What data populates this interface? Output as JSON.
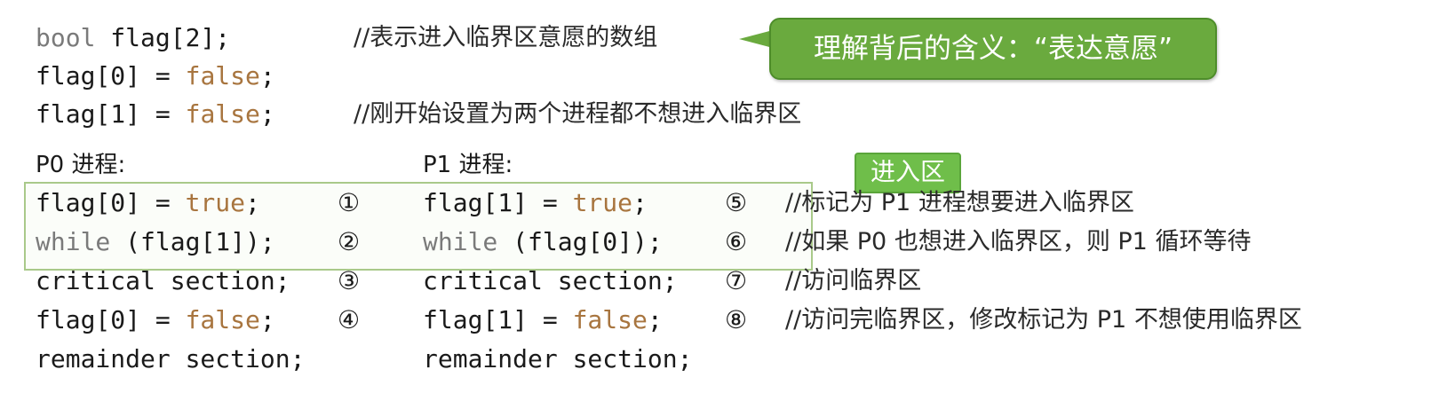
{
  "declarations": {
    "line1": {
      "type": "bool",
      "code": "flag[2];"
    },
    "line1_comment": "//表示进入临界区意愿的数组",
    "line2": {
      "lhs": "flag[0]",
      "eq": " = ",
      "val": "false",
      "end": ";"
    },
    "line3": {
      "lhs": "flag[1]",
      "eq": " = ",
      "val": "false",
      "end": ";"
    },
    "line3_comment": "//刚开始设置为两个进程都不想进入临界区"
  },
  "callout": {
    "text": "理解背后的含义：“表达意愿”"
  },
  "entry_label": "进入区",
  "p0": {
    "title": "P0 进程:",
    "lines": [
      {
        "a": "flag[0] = ",
        "b": "true",
        "c": ";"
      },
      {
        "a": "while",
        "b": " (flag[1]);",
        "c": ""
      },
      {
        "a": "critical section;",
        "b": "",
        "c": ""
      },
      {
        "a": "flag[0] = ",
        "b": "false",
        "c": ";"
      },
      {
        "a": "remainder section;",
        "b": "",
        "c": ""
      }
    ],
    "markers": [
      "①",
      "②",
      "③",
      "④"
    ]
  },
  "p1": {
    "title": "P1 进程:",
    "lines": [
      {
        "a": "flag[1] = ",
        "b": "true",
        "c": ";"
      },
      {
        "a": "while",
        "b": " (flag[0]);",
        "c": ""
      },
      {
        "a": "critical section;",
        "b": "",
        "c": ""
      },
      {
        "a": "flag[1] = ",
        "b": "false",
        "c": ";"
      },
      {
        "a": "remainder section;",
        "b": "",
        "c": ""
      }
    ],
    "markers": [
      "⑤",
      "⑥",
      "⑦",
      "⑧"
    ]
  },
  "comments": [
    "//标记为 P1 进程想要进入临界区",
    "//如果 P0 也想进入临界区，则 P1 循环等待",
    "//访问临界区",
    "//访问完临界区，修改标记为 P1 不想使用临界区"
  ]
}
